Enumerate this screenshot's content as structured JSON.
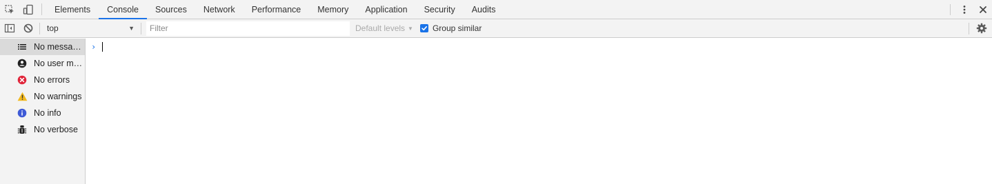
{
  "tabbar": {
    "tabs": [
      {
        "label": "Elements",
        "active": false
      },
      {
        "label": "Console",
        "active": true
      },
      {
        "label": "Sources",
        "active": false
      },
      {
        "label": "Network",
        "active": false
      },
      {
        "label": "Performance",
        "active": false
      },
      {
        "label": "Memory",
        "active": false
      },
      {
        "label": "Application",
        "active": false
      },
      {
        "label": "Security",
        "active": false
      },
      {
        "label": "Audits",
        "active": false
      }
    ],
    "accent": "#1a73e8"
  },
  "toolbar": {
    "context": "top",
    "filter_placeholder": "Filter",
    "filter_value": "",
    "levels_label": "Default levels",
    "group_similar_label": "Group similar",
    "group_similar_checked": true
  },
  "sidebar": {
    "items": [
      {
        "label": "No messages",
        "icon": "list-icon",
        "selected": true
      },
      {
        "label": "No user me…",
        "icon": "user-icon",
        "selected": false
      },
      {
        "label": "No errors",
        "icon": "error-icon",
        "selected": false
      },
      {
        "label": "No warnings",
        "icon": "warning-icon",
        "selected": false
      },
      {
        "label": "No info",
        "icon": "info-icon",
        "selected": false
      },
      {
        "label": "No verbose",
        "icon": "bug-icon",
        "selected": false
      }
    ]
  },
  "console": {
    "prompt_glyph": "›"
  },
  "colors": {
    "error": "#e0253a",
    "warning": "#f2b91f",
    "info": "#3e5ad6",
    "selected_item": "#dadada"
  }
}
